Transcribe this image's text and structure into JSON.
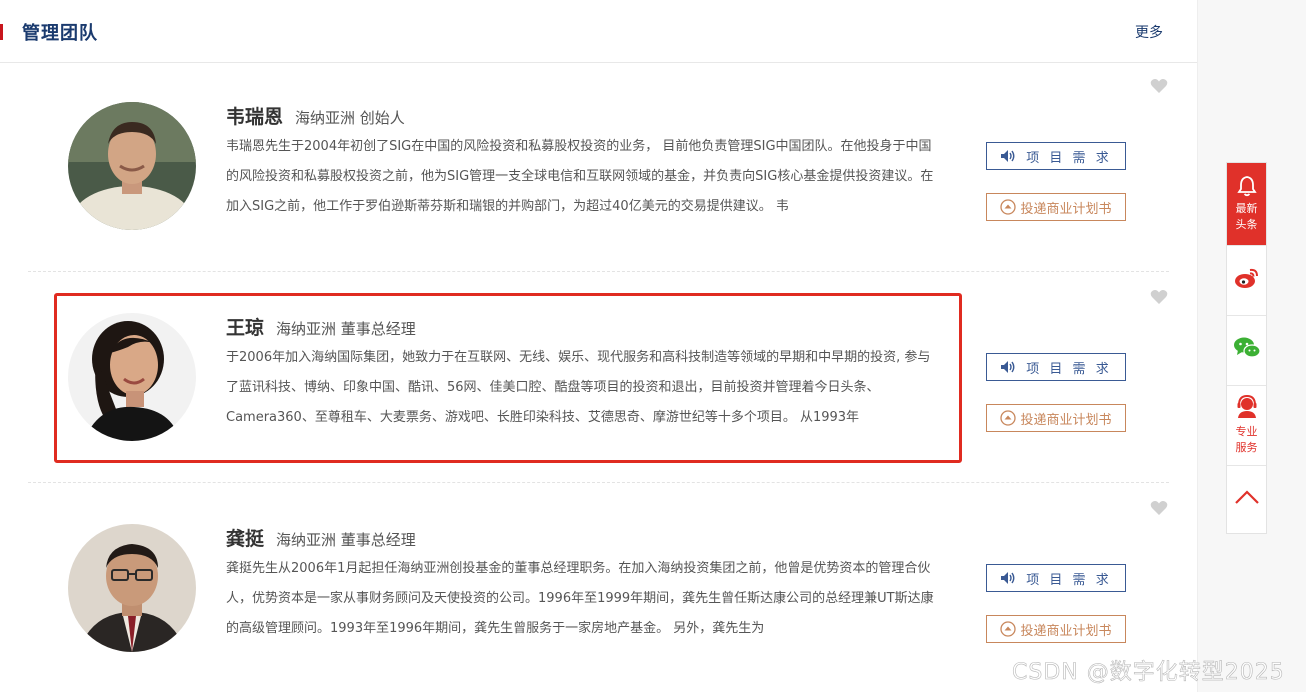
{
  "header": {
    "title": "管理团队",
    "more": "更多"
  },
  "buttons": {
    "demand": "项 目 需 求",
    "plan": "投递商业计划书"
  },
  "members": [
    {
      "name": "韦瑞恩",
      "title": "海纳亚洲 创始人",
      "desc": "韦瑞恩先生于2004年初创了SIG在中国的风险投资和私募股权投资的业务， 目前他负责管理SIG中国团队。在他投身于中国的风险投资和私募股权投资之前，他为SIG管理一支全球电信和互联网领域的基金，并负责向SIG核心基金提供投资建议。在加入SIG之前，他工作于罗伯逊斯蒂芬斯和瑞银的并购部门，为超过40亿美元的交易提供建议。 韦"
    },
    {
      "name": "王琼",
      "title": "海纳亚洲 董事总经理",
      "desc": "于2006年加入海纳国际集团，她致力于在互联网、无线、娱乐、现代服务和高科技制造等领域的早期和中早期的投资, 参与了蓝讯科技、博纳、印象中国、酷讯、56网、佳美口腔、酷盘等项目的投资和退出，目前投资并管理着今日头条、Camera360、至尊租车、大麦票务、游戏吧、长胜印染科技、艾德思奇、摩游世纪等十多个项目。 从1993年"
    },
    {
      "name": "龚挺",
      "title": "海纳亚洲 董事总经理",
      "desc": "龚挺先生从2006年1月起担任海纳亚洲创投基金的董事总经理职务。在加入海纳投资集团之前，他曾是优势资本的管理合伙人，优势资本是一家从事财务顾问及天使投资的公司。1996年至1999年期间，龚先生曾任斯达康公司的总经理兼UT斯达康的高级管理顾问。1993年至1996年期间，龚先生曾服务于一家房地产基金。 另外，龚先生为"
    }
  ],
  "sidebar": {
    "news": "最新头条",
    "service": "专业服务"
  },
  "watermark": "CSDN @数字化转型2025",
  "colors": {
    "accent": "#c8161d",
    "brand_blue": "#1a3a6e",
    "demand_blue": "#3a5a94",
    "plan_orange": "#c8875c",
    "highlight": "#e02b20"
  },
  "icons": [
    "speaker-icon",
    "upload-icon",
    "heart-icon",
    "bell-icon",
    "weibo-icon",
    "wechat-icon",
    "service-icon",
    "arrow-up-icon"
  ]
}
